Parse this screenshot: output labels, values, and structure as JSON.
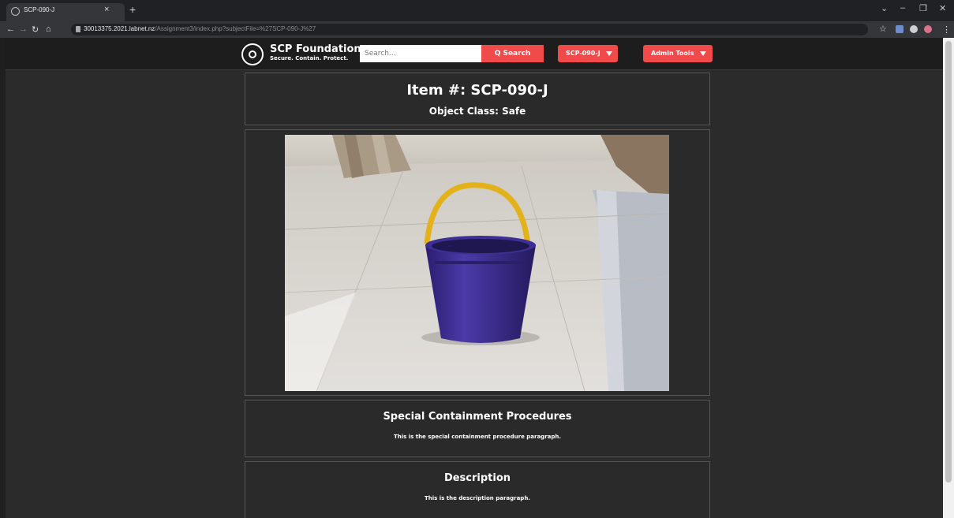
{
  "browser": {
    "tab_title": "SCP-090-J",
    "tab_close": "×",
    "new_tab": "+",
    "url_host": "30013375.2021.labnet.nz",
    "url_path": "/Assignment3/index.php?subjectFile=%27SCP-090-J%27"
  },
  "nav": {
    "brand_name": "SCP Foundation",
    "brand_tagline": "Secure. Contain. Protect.",
    "search_placeholder": "Search...",
    "search_button": "Q Search",
    "dropdown_item": "SCP-090-J",
    "dropdown_admin": "Admin Tools"
  },
  "item": {
    "title": "Item #: SCP-090-J",
    "object_class": "Object Class: Safe",
    "image_subject": "purple bucket with yellow handle on tiled floor"
  },
  "sections": [
    {
      "title": "Special Containment Procedures",
      "text": "This is the special containment procedure paragraph."
    },
    {
      "title": "Description",
      "text": "This is the description paragraph."
    }
  ],
  "colors": {
    "accent": "#f04a4a",
    "page_bg": "#2b2b2b",
    "nav_bg": "#1d1d1d"
  }
}
